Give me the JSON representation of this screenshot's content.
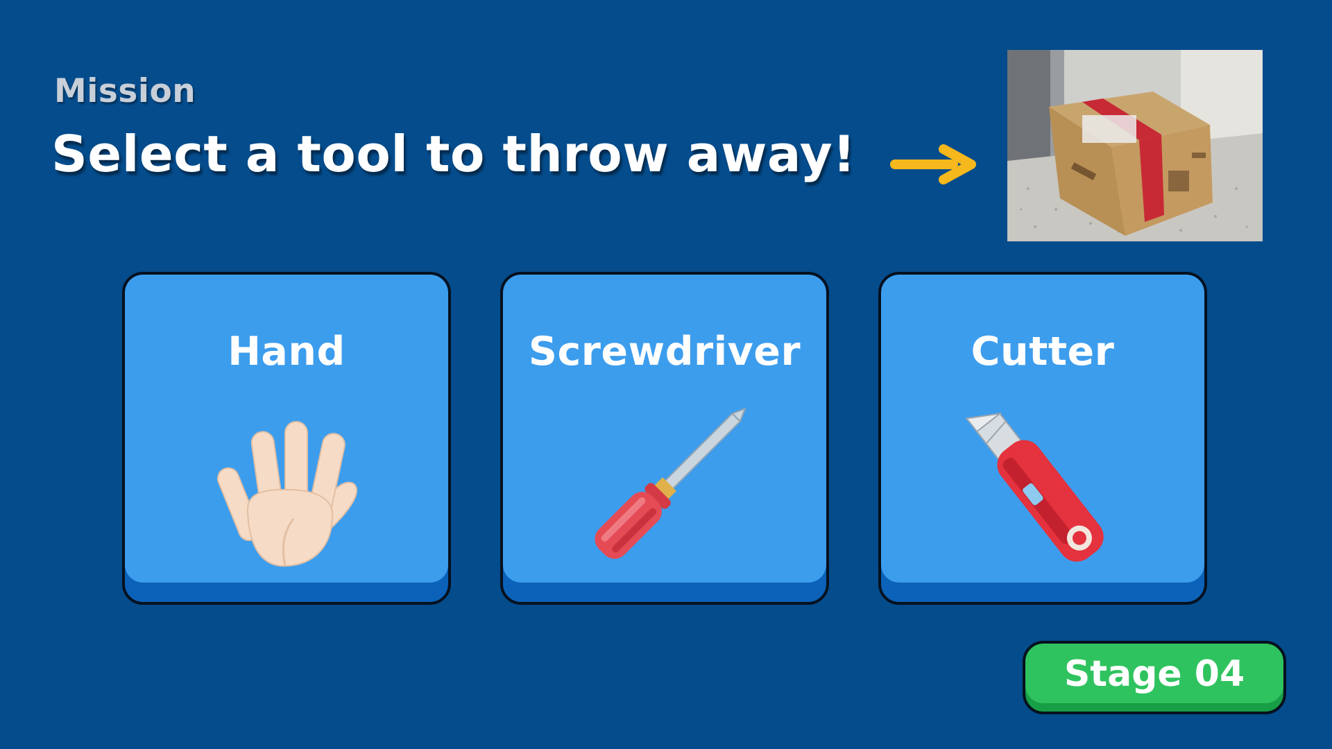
{
  "mission": {
    "label": "Mission",
    "title": "Select a tool to throw away!"
  },
  "target": {
    "image_subject": "cardboard-box-photo"
  },
  "tools": [
    {
      "label": "Hand",
      "icon": "hand-icon"
    },
    {
      "label": "Screwdriver",
      "icon": "screwdriver-icon"
    },
    {
      "label": "Cutter",
      "icon": "cutter-icon"
    }
  ],
  "stage": {
    "label": "Stage 04"
  },
  "colors": {
    "background": "#044c8c",
    "card_face": "#3d9ded",
    "card_base": "#0b62b8",
    "arrow": "#f6b81c",
    "stage_badge": "#2fc35f"
  }
}
